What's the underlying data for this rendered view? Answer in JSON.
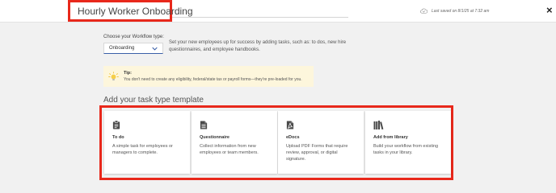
{
  "header": {
    "title": "Hourly Worker Onboarding",
    "last_saved": "Last saved on 8/1/25 at 7:32 am",
    "close_label": "×"
  },
  "workflow": {
    "label": "Choose your Workflow type:",
    "selected": "Onboarding",
    "description": "Set your new employees up for success by adding tasks, such as: to dos, new hire questionnaires, and employee handbooks."
  },
  "tip": {
    "title": "Tip:",
    "text": "You don't need to create any eligibility, federal/state tax or payroll forms—they're pre-loaded for you."
  },
  "templates": {
    "heading": "Add your task type template",
    "cards": [
      {
        "title": "To do",
        "description": "A simple task for employees or managers to complete.",
        "icon": "clipboard-icon"
      },
      {
        "title": "Questionnaire",
        "description": "Collect information from new employees or team members.",
        "icon": "document-icon"
      },
      {
        "title": "eDocs",
        "description": "Upload PDF Forms that require review, approval, or digital signature.",
        "icon": "pdf-icon"
      },
      {
        "title": "Add from library",
        "description": "Build your workflow from existing tasks in your library.",
        "icon": "library-icon"
      }
    ]
  },
  "colors": {
    "highlight": "#e8281b",
    "tip_background": "#fdf6dc",
    "select_underline": "#3a5fa8",
    "page_background": "#f1f1f1"
  }
}
